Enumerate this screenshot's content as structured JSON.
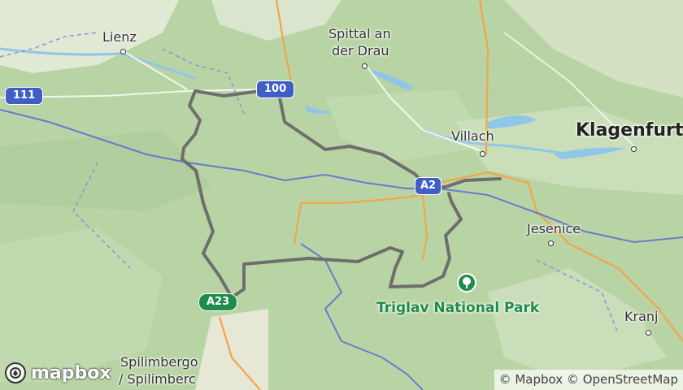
{
  "map": {
    "places": {
      "lienz": "Lienz",
      "spittal": "Spittal an der Drau",
      "villach": "Villach",
      "klagenfurt": "Klagenfurt",
      "jesenice": "Jesenice",
      "kranj": "Kranj",
      "spilimbergo_1": "Spilimbergo",
      "spilimbergo_2": "/ Spilimberc"
    },
    "spittal_lines": [
      "Spittal an",
      "der Drau"
    ],
    "shields": {
      "road_111": "111",
      "road_100": "100",
      "road_a2": "A2",
      "road_a23": "A23"
    },
    "park_label": "Triglav National Park",
    "logo_text": "mapbox",
    "attribution": {
      "mapbox": "© Mapbox",
      "osm": "© OpenStreetMap"
    },
    "colors": {
      "terrain": "#b9d4a4",
      "water": "#8fc7e8",
      "route": "#6e6e6e",
      "border": "#5a6bd6",
      "major_road": "#f2a54a",
      "park": "#1e8c4a"
    }
  }
}
